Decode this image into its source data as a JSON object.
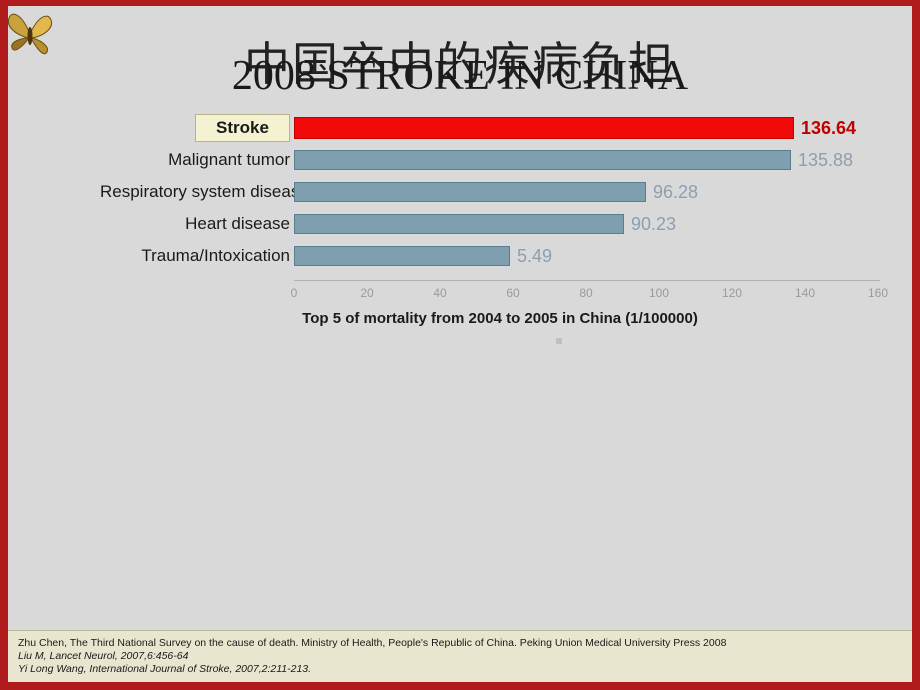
{
  "slide": {
    "title_cn": "中国卒中的疾病负担",
    "title_en": "STROKE IN CHINA",
    "title_en_overlay": "2008",
    "accent_color": "#b01c1c",
    "background_color": "#d9d9d9"
  },
  "chart_data": {
    "type": "bar",
    "orientation": "horizontal",
    "title": "",
    "caption": "Top 5 of mortality from 2004 to 2005 in China (1/100000)",
    "categories": [
      "Stroke",
      "Malignant tumor",
      "Respiratory system disease",
      "Heart disease",
      "Trauma/Intoxication"
    ],
    "values": [
      136.64,
      135.88,
      96.28,
      90.23,
      5.49
    ],
    "value_labels": [
      "136.64",
      "135.88",
      "96.28",
      "90.23",
      "5.49"
    ],
    "highlight_index": 0,
    "highlight_color": "#f20a0a",
    "bar_color": "#7d9fb0",
    "xlabel": "",
    "ylabel": "",
    "xlim": [
      0,
      160
    ],
    "ticks": [
      "0",
      "20",
      "40",
      "60",
      "80",
      "100",
      "120",
      "140",
      "160"
    ],
    "tick_values": [
      0,
      20,
      40,
      60,
      80,
      100,
      120,
      140,
      160
    ],
    "grid": false,
    "legend": "none"
  },
  "footnote": {
    "lines": [
      "Zhu Chen, The Third National Survey on the cause of death. Ministry of Health, People's Republic of China. Peking Union Medical University Press 2008",
      "Liu M, Lancet Neurol, 2007,6:456-64",
      "Yi Long Wang, International Journal of Stroke, 2007,2:211-213."
    ]
  }
}
